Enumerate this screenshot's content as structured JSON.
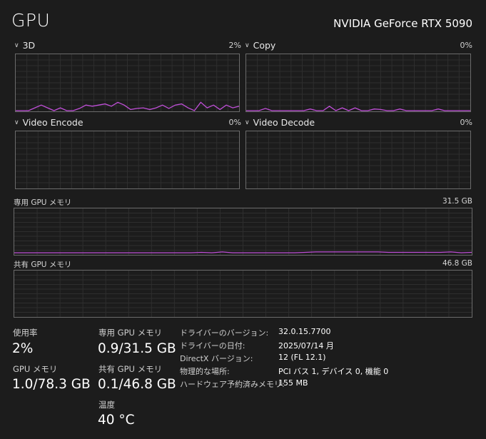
{
  "header": {
    "title": "GPU",
    "gpu_name": "NVIDIA GeForce RTX 5090"
  },
  "engines": [
    {
      "label": "3D",
      "percent": "2%",
      "data": [
        0,
        0,
        0,
        0.05,
        0.1,
        0.05,
        0,
        0.05,
        0,
        0,
        0.04,
        0.1,
        0.08,
        0.1,
        0.12,
        0.08,
        0.15,
        0.1,
        0.02,
        0.04,
        0.05,
        0.02,
        0.05,
        0.1,
        0.04,
        0.1,
        0.12,
        0.05,
        0,
        0.15,
        0.05,
        0.1,
        0.02,
        0.1,
        0.05,
        0.08
      ]
    },
    {
      "label": "Copy",
      "percent": "0%",
      "data": [
        0,
        0,
        0,
        0.04,
        0,
        0,
        0,
        0,
        0,
        0,
        0.03,
        0,
        0,
        0.08,
        0,
        0.05,
        0,
        0.05,
        0,
        0,
        0.03,
        0.02,
        0,
        0,
        0.03,
        0,
        0,
        0,
        0,
        0,
        0.03,
        0,
        0,
        0,
        0,
        0
      ]
    },
    {
      "label": "Video Encode",
      "percent": "0%",
      "data": []
    },
    {
      "label": "Video Decode",
      "percent": "0%",
      "data": []
    }
  ],
  "memory": {
    "dedicated": {
      "label": "専用 GPU メモリ",
      "max": "31.5 GB",
      "data": [
        0.03,
        0.03,
        0.03,
        0.03,
        0.03,
        0.03,
        0.03,
        0.03,
        0.03,
        0.03,
        0.03,
        0.03,
        0.03,
        0.03,
        0.03,
        0.03,
        0.03,
        0.03,
        0.04,
        0.03,
        0.05,
        0.03,
        0.03,
        0.03,
        0.03,
        0.03,
        0.03,
        0.03,
        0.04,
        0.05,
        0.05,
        0.05,
        0.05,
        0.05,
        0.05,
        0.05,
        0.04,
        0.04,
        0.04,
        0.04,
        0.04,
        0.04,
        0.05,
        0.03,
        0.04
      ]
    },
    "shared": {
      "label": "共有 GPU メモリ",
      "max": "46.8 GB",
      "data": []
    }
  },
  "stats": {
    "utilization": {
      "label": "使用率",
      "value": "2%"
    },
    "dedicated_mem": {
      "label": "専用 GPU メモリ",
      "value": "0.9/31.5 GB"
    },
    "gpu_mem": {
      "label": "GPU メモリ",
      "value": "1.0/78.3 GB"
    },
    "shared_mem": {
      "label": "共有 GPU メモリ",
      "value": "0.1/46.8 GB"
    },
    "temp": {
      "label": "温度",
      "value": "40 °C"
    }
  },
  "info": [
    {
      "label": "ドライバーのバージョン:",
      "value": "32.0.15.7700"
    },
    {
      "label": "ドライバーの日付:",
      "value": "2025/07/14 月"
    },
    {
      "label": "DirectX バージョン:",
      "value": "12 (FL 12.1)"
    },
    {
      "label": "物理的な場所:",
      "value": "PCI バス 1, デバイス 0, 機能 0"
    },
    {
      "label": "ハードウェア予約済みメモリ:",
      "value": "155 MB"
    }
  ],
  "colors": {
    "line": "#c04fd8",
    "grid": "#2e2e2e",
    "border": "#6b6b6b"
  },
  "icons": {
    "engine_toggle": "chevron-down-icon"
  }
}
